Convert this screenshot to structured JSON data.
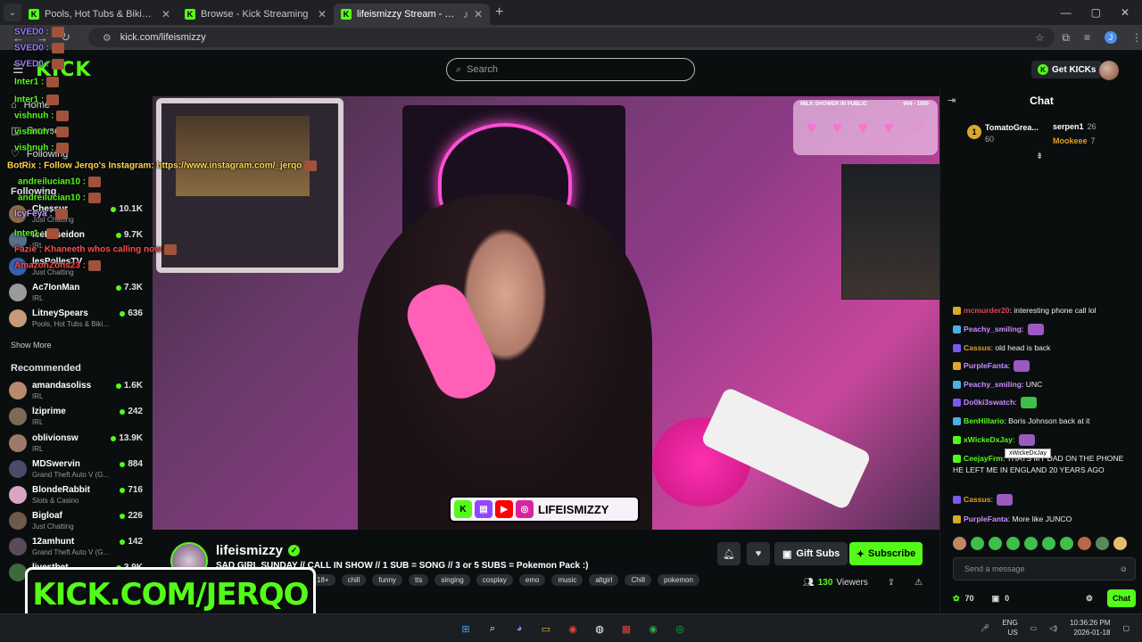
{
  "browser": {
    "tabs": [
      {
        "title": "Pools, Hot Tubs & Bikinis Strea"
      },
      {
        "title": "Browse - Kick Streaming"
      },
      {
        "title": "lifeismizzy Stream - Watch"
      }
    ],
    "url": "kick.com/lifeismizzy",
    "profile_initial": "J"
  },
  "header": {
    "logo": "KICK",
    "search_placeholder": "Search",
    "get_kicks": "Get KICKs"
  },
  "sidebar": {
    "nav": [
      {
        "label": "Home"
      },
      {
        "label": "Browse"
      },
      {
        "label": "Following"
      }
    ],
    "following_label": "Following",
    "following": [
      {
        "name": "Chessur",
        "category": "Just Chatting",
        "viewers": "10.1K"
      },
      {
        "name": "IcePoseidon",
        "category": "IRL",
        "viewers": "9.7K"
      },
      {
        "name": "lesPollesTV",
        "category": "Just Chatting",
        "viewers": ""
      },
      {
        "name": "Ac7IonMan",
        "category": "IRL",
        "viewers": "7.3K"
      },
      {
        "name": "LitneySpears",
        "category": "Pools, Hot Tubs & Biki...",
        "viewers": "636"
      }
    ],
    "show_more": "Show More",
    "recommended_label": "Recommended",
    "recommended": [
      {
        "name": "amandasoliss",
        "category": "IRL",
        "viewers": "1.6K"
      },
      {
        "name": "lziprime",
        "category": "IRL",
        "viewers": "242"
      },
      {
        "name": "oblivionsw",
        "category": "IRL",
        "viewers": "13.9K"
      },
      {
        "name": "MDSwervin",
        "category": "Grand Theft Auto V (G...",
        "viewers": "884"
      },
      {
        "name": "BlondeRabbit",
        "category": "Slots & Casino",
        "viewers": "716"
      },
      {
        "name": "Bigloaf",
        "category": "Just Chatting",
        "viewers": "226"
      },
      {
        "name": "12amhunt",
        "category": "Grand Theft Auto V (G...",
        "viewers": "142"
      },
      {
        "name": "livestbet",
        "category": "",
        "viewers": "3.9K"
      }
    ]
  },
  "overlay_chat": [
    {
      "user": "SVED0 :",
      "color": "#9b7bff"
    },
    {
      "user": "SVED0 :",
      "color": "#9b7bff"
    },
    {
      "user": "SVED0 :",
      "color": "#9b7bff"
    },
    {
      "user": "Inter1 :",
      "color": "#53fc18"
    },
    {
      "user": "Inter1 :",
      "color": "#53fc18"
    },
    {
      "user": "vishnuh :",
      "color": "#53fc18"
    },
    {
      "user": "vishnuh :",
      "color": "#53fc18"
    },
    {
      "user": "vishnuh :",
      "color": "#53fc18"
    },
    {
      "user": "BotRix : Follow Jerqo's Instagram: https://www.instagram.com/_jerqo",
      "color": "#ffd84a"
    },
    {
      "user": "andreilucian10 :",
      "color": "#53fc18"
    },
    {
      "user": "andreilucian10 :",
      "color": "#53fc18"
    },
    {
      "user": "IcyFeya :",
      "color": "#c9a0ff"
    },
    {
      "user": "Inter1 :",
      "color": "#53fc18"
    },
    {
      "user": "Fazie : Khaneeth whos calling now",
      "color": "#ff4d4d"
    },
    {
      "user": "AmazonZons23 :",
      "color": "#ff4d4d"
    }
  ],
  "brand_overlay": "KICK.COM/JERQO",
  "video": {
    "milk_caption": "MILK SHOWER IN PUBLIC",
    "milk_progress": "904 - 1000",
    "social_handle": "LIFEISMIZZY"
  },
  "stream": {
    "streamer": "lifeismizzy",
    "title": "SAD GIRL SUNDAY // CALL IN SHOW // 1 SUB = SONG // 3 or 5 SUBS = Pokemon Pack :)",
    "tags": [
      "18+",
      "chill",
      "funny",
      "tts",
      "singing",
      "cosplay",
      "emo",
      "music",
      "altgirl",
      "Chill",
      "pokemon"
    ],
    "viewers": "130",
    "viewers_label": "Viewers",
    "gift_subs": "Gift Subs",
    "subscribe": "Subscribe"
  },
  "chat": {
    "title": "Chat",
    "leaderboard": [
      {
        "rank": "1",
        "name": "TomatoGrea...",
        "value": "60"
      },
      {
        "name": "serpen1",
        "value": "26"
      },
      {
        "name": "Mookeee",
        "value": "7"
      }
    ],
    "messages": [
      {
        "user": "mcmurder20",
        "color": "#e0445a",
        "text": "interesting phone call lol"
      },
      {
        "user": "Peachy_smiling",
        "color": "#c98cff",
        "text": ""
      },
      {
        "user": "Cassus",
        "color": "#e0a020",
        "text": "old head is back"
      },
      {
        "user": "PurpleFanta",
        "color": "#c98cff",
        "text": ""
      },
      {
        "user": "Peachy_smiling",
        "color": "#c98cff",
        "text": "UNC"
      },
      {
        "user": "Do0ki3swatch",
        "color": "#c98cff",
        "text": ""
      },
      {
        "user": "BenHillario",
        "color": "#53fc18",
        "text": "Boris Johnson back at it"
      },
      {
        "user": "xWickeDxJay",
        "color": "#53fc18",
        "text": ""
      },
      {
        "user": "CeejayFrm",
        "color": "#53fc18",
        "text": "THATS MY DAD ON THE PHONE HE LEFT ME IN ENGLAND 20 YEARS AGO"
      },
      {
        "user": "Cassus",
        "color": "#e0a020",
        "text": ""
      },
      {
        "user": "PurpleFanta",
        "color": "#c98cff",
        "text": "More like JUNCO"
      }
    ],
    "tooltip": "xWickeDxJay",
    "input_placeholder": "Send a message",
    "kicks_count": "70",
    "gift_count": "0",
    "chat_button": "Chat"
  },
  "taskbar": {
    "lang": "ENG",
    "region": "US",
    "time": "10:36:26 PM",
    "date": "2026-01-18"
  },
  "colors": {
    "accent": "#53fc18",
    "background": "#0b0e0f"
  }
}
